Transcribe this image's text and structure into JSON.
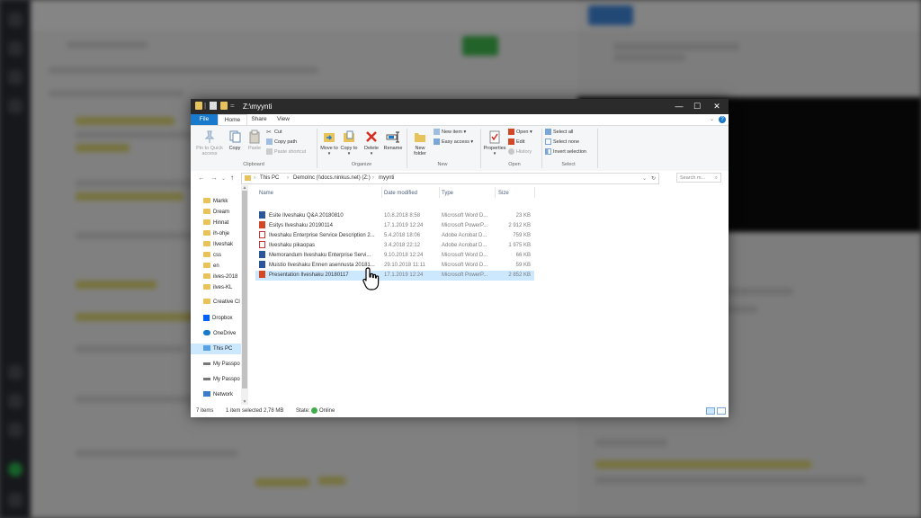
{
  "window": {
    "title": "Z:\\myynti",
    "controls": {
      "minimize": "—",
      "maximize": "☐",
      "close": "✕"
    }
  },
  "tabs": {
    "file": "File",
    "home": "Home",
    "share": "Share",
    "view": "View"
  },
  "ribbon": {
    "clipboard": {
      "group": "Clipboard",
      "pin": "Pin to Quick access",
      "copy": "Copy",
      "paste": "Paste",
      "cut": "Cut",
      "copy_path": "Copy path",
      "paste_shortcut": "Paste shortcut"
    },
    "organize": {
      "group": "Organize",
      "move_to": "Move to",
      "copy_to": "Copy to",
      "delete": "Delete",
      "rename": "Rename"
    },
    "new": {
      "group": "New",
      "new_folder": "New folder",
      "new_item": "New item",
      "easy_access": "Easy access"
    },
    "open": {
      "group": "Open",
      "properties": "Properties",
      "open": "Open",
      "edit": "Edit",
      "history": "History"
    },
    "select": {
      "group": "Select",
      "select_all": "Select all",
      "select_none": "Select none",
      "invert_selection": "Invert selection"
    }
  },
  "address": {
    "crumbs": [
      "This PC",
      "DemoInc (\\\\docs.ninkus.net) (Z:)",
      "myynti"
    ],
    "search_placeholder": "Search m..."
  },
  "nav": {
    "items": [
      "Markk",
      "Dream",
      "Hinnat",
      "ih-ohje",
      "Ilveshak",
      "css",
      "en",
      "ilves-2018",
      "ilves-KL",
      "Creative Cl",
      "Dropbox",
      "OneDrive",
      "This PC",
      "My Passpo",
      "My Passpo",
      "Network"
    ]
  },
  "columns": {
    "name": "Name",
    "date": "Date modified",
    "type": "Type",
    "size": "Size"
  },
  "files": [
    {
      "name": "Esite Ilveshaku Q&A 20180810",
      "date": "10.8.2018 8:58",
      "type": "Microsoft Word D...",
      "size": "23 KB",
      "kind": "word"
    },
    {
      "name": "Esitys Ilveshaku 20190114",
      "date": "17.1.2019 12:24",
      "type": "Microsoft PowerP...",
      "size": "2 912 KB",
      "kind": "ppt"
    },
    {
      "name": "Ilveshaku Enterprise Service Description 2...",
      "date": "5.4.2018 18:06",
      "type": "Adobe Acrobat D...",
      "size": "759 KB",
      "kind": "pdf"
    },
    {
      "name": "Ilveshaku pikaopas",
      "date": "3.4.2018 22:12",
      "type": "Adobe Acrobat D...",
      "size": "1 975 KB",
      "kind": "pdf"
    },
    {
      "name": "Memorandum Ilveshaku Enterprise Servi...",
      "date": "9.10.2018 12:24",
      "type": "Microsoft Word D...",
      "size": "66 KB",
      "kind": "word"
    },
    {
      "name": "Muistio Ilveshaku Ennen asennusta 20181...",
      "date": "29.10.2018 11:11",
      "type": "Microsoft Word D...",
      "size": "59 KB",
      "kind": "word"
    },
    {
      "name": "Presentation Ilveshaku 20180117",
      "date": "17.1.2019 12:24",
      "type": "Microsoft PowerP...",
      "size": "2 852 KB",
      "kind": "ppt"
    }
  ],
  "selected_index": 6,
  "status": {
    "items": "7 items",
    "selected": "1 item selected  2,78 MB",
    "state_label": "State:",
    "state_value": "Online"
  },
  "colors": {
    "accent": "#1979ca",
    "selection": "#cce8ff",
    "titlebar": "#2b2b2b"
  }
}
